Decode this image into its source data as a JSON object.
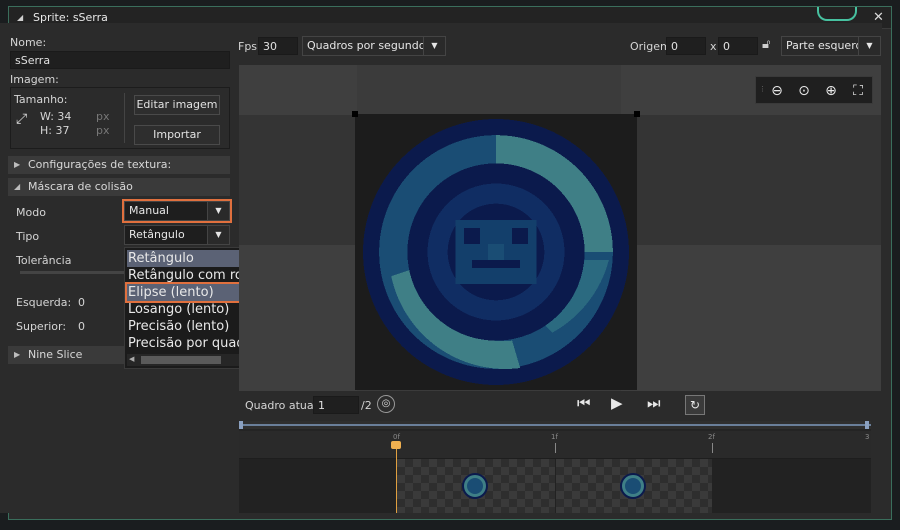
{
  "window": {
    "title": "Sprite: sSerra"
  },
  "left": {
    "name_label": "Nome:",
    "name_value": "sSerra",
    "image_label": "Imagem:",
    "size_label": "Tamanho:",
    "width_label": "W: 34",
    "height_label": "H: 37",
    "px_w": "px",
    "px_h": "px",
    "edit_image": "Editar imagem",
    "import": "Importar",
    "texture_section": "Configurações de textura:",
    "collision_section": "Máscara de colisão",
    "mode_label": "Modo",
    "mode_value": "Manual",
    "type_label": "Tipo",
    "type_value": "Retângulo",
    "tolerance_label": "Tolerância",
    "left_label": "Esquerda:",
    "left_value": "0",
    "top_label": "Superior:",
    "top_value": "0",
    "nine_slice": "Nine Slice"
  },
  "dropdown": {
    "options": [
      "Retângulo",
      "Retângulo com rotação",
      "Elipse (lento)",
      "Losango (lento)",
      "Precisão (lento)",
      "Precisão por quadro"
    ]
  },
  "toolbar": {
    "fps_label": "Fps",
    "fps_value": "30",
    "fps_mode": "Quadros por segundo",
    "origin_label": "Origem",
    "origin_x": "0",
    "x_sep": "x",
    "origin_y": "0",
    "origin_preset": "Parte esquerda"
  },
  "playback": {
    "frame_label": "Quadro atual:",
    "frame_value": "1",
    "frame_total": "/2"
  },
  "timeline": {
    "ticks": [
      "0f",
      "1f",
      "2f",
      "3"
    ]
  },
  "colors": {
    "accent": "#e0703e",
    "teal": "#3f7f86",
    "dark_blue": "#0b1a4c"
  }
}
